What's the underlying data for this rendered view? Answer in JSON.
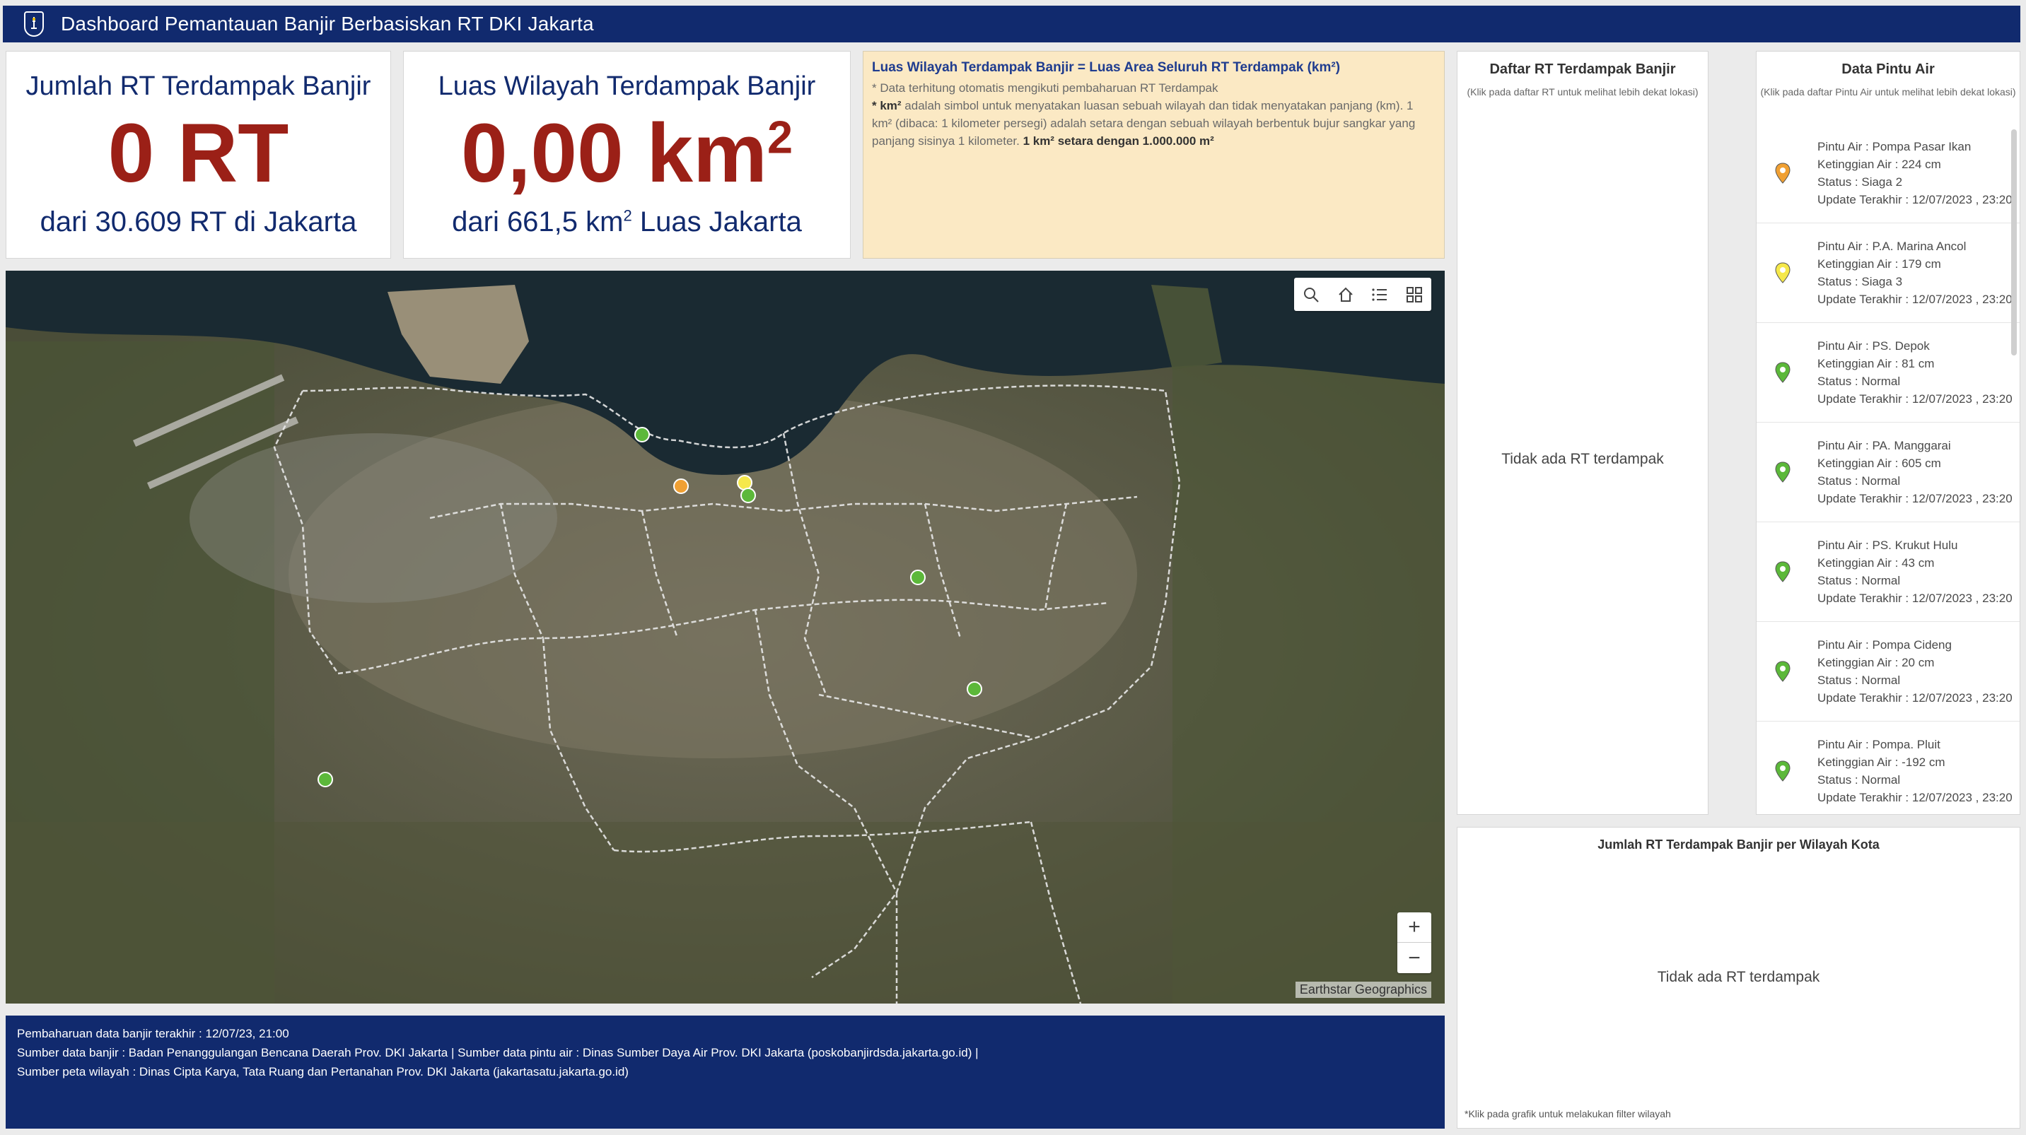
{
  "header": {
    "title": "Dashboard Pemantauan Banjir Berbasiskan RT DKI Jakarta"
  },
  "kpi_rt": {
    "title": "Jumlah RT Terdampak Banjir",
    "value": "0 RT",
    "subtitle": "dari 30.609 RT di Jakarta"
  },
  "kpi_area": {
    "title": "Luas Wilayah Terdampak Banjir",
    "value": "0,00 km",
    "value_sup": "2",
    "subtitle": "dari 661,5 km",
    "subtitle_sup": "2",
    "subtitle_tail": " Luas Jakarta"
  },
  "info": {
    "head": "Luas Wilayah Terdampak Banjir = Luas Area Seluruh RT Terdampak (km²)",
    "line1": "* Data terhitung otomatis mengikuti pembaharuan RT Terdampak",
    "line2_bold": "* km²",
    "line2_rest": " adalah simbol untuk menyatakan luasan sebuah wilayah dan tidak menyatakan panjang (km). 1 km² (dibaca: 1 kilometer persegi) adalah setara dengan sebuah wilayah berbentuk bujur sangkar yang panjang sisinya 1 kilometer. ",
    "line2_tail_bold": "1 km² setara dengan 1.000.000 m²"
  },
  "map": {
    "attribution": "Earthstar Geographics",
    "zoom_in": "+",
    "zoom_out": "−"
  },
  "footer": {
    "line1": "Pembaharuan data banjir terakhir : 12/07/23, 21:00",
    "line2": "Sumber data banjir : Badan Penanggulangan Bencana Daerah Prov. DKI Jakarta | Sumber data pintu air : Dinas Sumber Daya Air Prov. DKI Jakarta (poskobanjirdsda.jakarta.go.id) |",
    "line3": "Sumber peta wilayah : Dinas Cipta Karya, Tata Ruang dan Pertanahan Prov. DKI Jakarta (jakartasatu.jakarta.go.id)"
  },
  "rt_list": {
    "title": "Daftar RT Terdampak Banjir",
    "subtitle": "(Klik pada daftar RT untuk melihat lebih dekat lokasi)",
    "empty": "Tidak ada RT terdampak"
  },
  "gates": {
    "title": "Data Pintu Air",
    "subtitle": "(Klik pada daftar Pintu Air untuk melihat lebih dekat lokasi)",
    "items": [
      {
        "name": "Pintu Air : Pompa Pasar Ikan",
        "level": "Ketinggian Air : 224 cm",
        "status": "Status : Siaga 2",
        "update": "Update Terakhir : 12/07/2023 , 23:20",
        "color": "#f0a033"
      },
      {
        "name": "Pintu Air : P.A. Marina Ancol",
        "level": "Ketinggian Air : 179 cm",
        "status": "Status : Siaga 3",
        "update": "Update Terakhir : 12/07/2023 , 23:20",
        "color": "#f5e84a"
      },
      {
        "name": "Pintu Air : PS. Depok",
        "level": "Ketinggian Air : 81 cm",
        "status": "Status : Normal",
        "update": "Update Terakhir : 12/07/2023 , 23:20",
        "color": "#5cb83a"
      },
      {
        "name": "Pintu Air : PA. Manggarai",
        "level": "Ketinggian Air : 605 cm",
        "status": "Status : Normal",
        "update": "Update Terakhir : 12/07/2023 , 23:20",
        "color": "#5cb83a"
      },
      {
        "name": "Pintu Air : PS. Krukut Hulu",
        "level": "Ketinggian Air : 43 cm",
        "status": "Status : Normal",
        "update": "Update Terakhir : 12/07/2023 , 23:20",
        "color": "#5cb83a"
      },
      {
        "name": "Pintu Air : Pompa Cideng",
        "level": "Ketinggian Air : 20 cm",
        "status": "Status : Normal",
        "update": "Update Terakhir : 12/07/2023 , 23:20",
        "color": "#5cb83a"
      },
      {
        "name": "Pintu Air : Pompa. Pluit",
        "level": "Ketinggian Air : -192 cm",
        "status": "Status : Normal",
        "update": "Update Terakhir : 12/07/2023 , 23:20",
        "color": "#5cb83a"
      }
    ]
  },
  "chart_panel": {
    "title": "Jumlah RT Terdampak Banjir per Wilayah Kota",
    "empty": "Tidak ada RT terdampak",
    "note": "*Klik pada grafik untuk melakukan filter wilayah"
  }
}
